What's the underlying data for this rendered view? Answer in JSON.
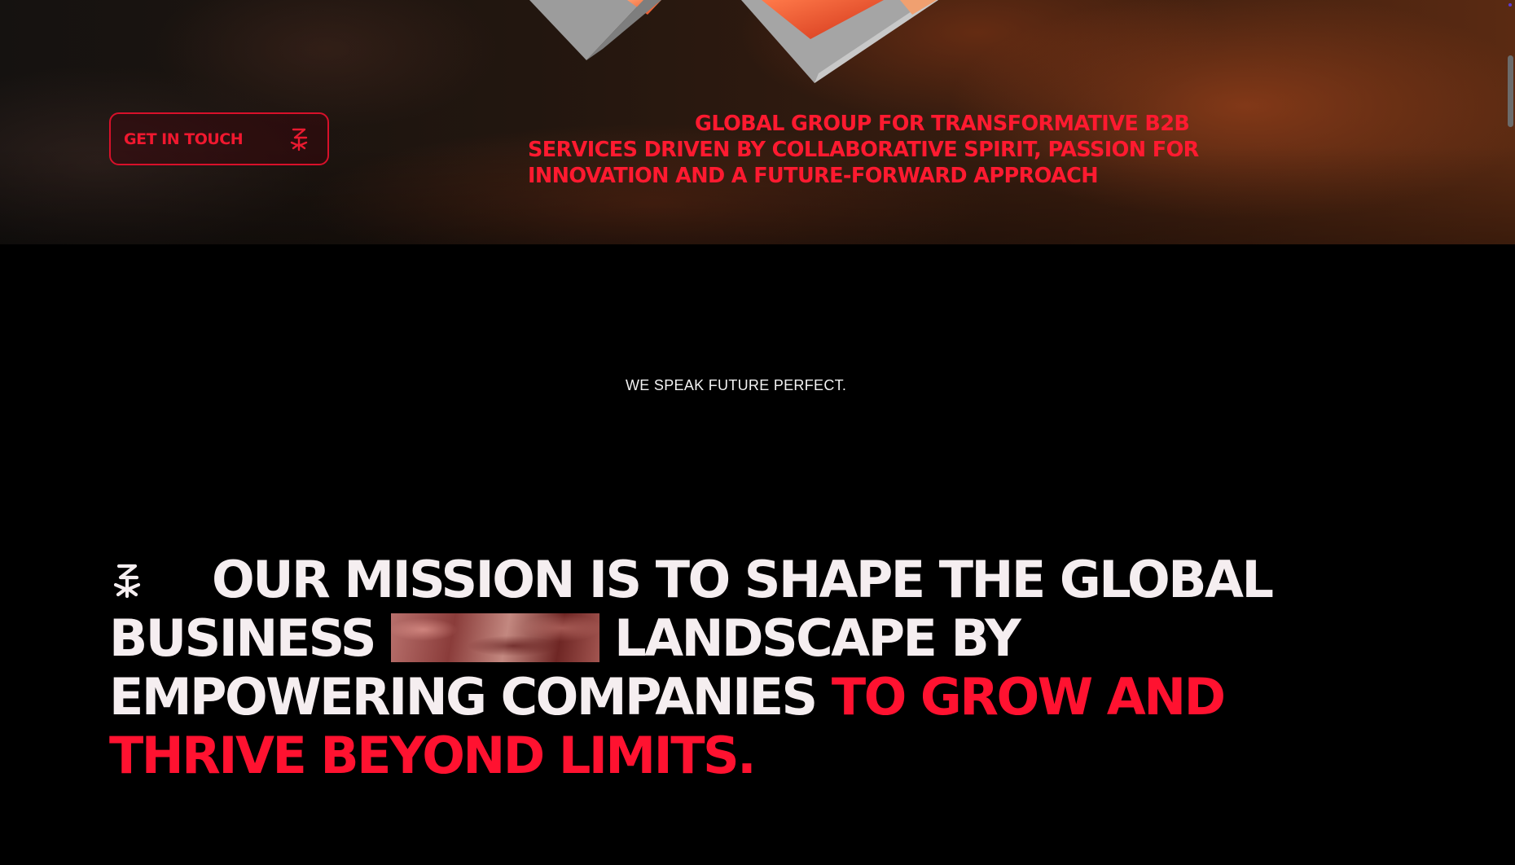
{
  "hero": {
    "cta_label": "GET IN TOUCH",
    "tagline": "GLOBAL GROUP FOR TRANSFORMATIVE B2B SERVICES DRIVEN BY COLLABORATIVE SPIRIT, PASSION FOR INNOVATION AND A FUTURE-FORWARD APPROACH"
  },
  "eyebrow": "WE SPEAK FUTURE PERFECT.",
  "mission": {
    "line_white_1": "OUR MISSION IS TO SHAPE THE GLOBAL BUSINESS",
    "line_white_2": "LANDSCAPE BY EMPOWERING COMPANIES",
    "line_red": "TO GROW AND THRIVE BEYOND LIMITS."
  },
  "icons": {
    "cta": "brand-logo-icon",
    "mission": "brand-logo-icon"
  },
  "colors": {
    "accent_red": "#ff1230",
    "background": "#000000",
    "text_light": "#f5eef0"
  }
}
